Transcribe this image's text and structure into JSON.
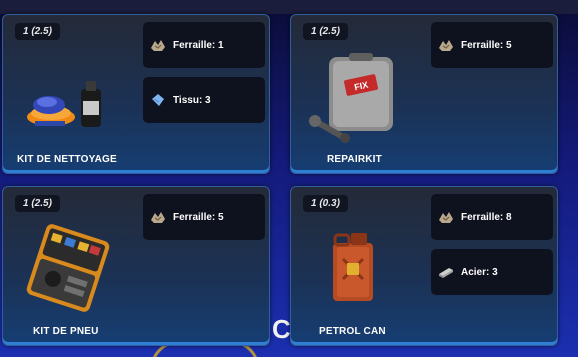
{
  "cards": [
    {
      "quantity": "1 (2.5)",
      "title": "KIT DE NETTOYAGE",
      "item_icon": "cleaning-kit-icon",
      "materials": [
        {
          "label": "Ferraille: 1",
          "icon": "scrap-icon"
        },
        {
          "label": "Tissu: 3",
          "icon": "cloth-icon"
        }
      ]
    },
    {
      "quantity": "1 (2.5)",
      "title": "REPAIRKIT",
      "item_icon": "repair-kit-icon",
      "materials": [
        {
          "label": "Ferraille: 5",
          "icon": "scrap-icon"
        }
      ]
    },
    {
      "quantity": "1 (2.5)",
      "title": "KIT DE PNEU",
      "item_icon": "tire-kit-icon",
      "materials": [
        {
          "label": "Ferraille: 5",
          "icon": "scrap-icon"
        }
      ]
    },
    {
      "quantity": "1 (0.3)",
      "title": "PETROL CAN",
      "item_icon": "petrol-can-icon",
      "materials": [
        {
          "label": "Ferraille: 8",
          "icon": "scrap-icon"
        },
        {
          "label": "Acier: 3",
          "icon": "steel-icon"
        }
      ]
    }
  ],
  "background": {
    "letter": "C"
  },
  "colors": {
    "accent": "#2f7fd6",
    "card_bg": "#1b3256",
    "chip_bg": "#0e121e"
  }
}
